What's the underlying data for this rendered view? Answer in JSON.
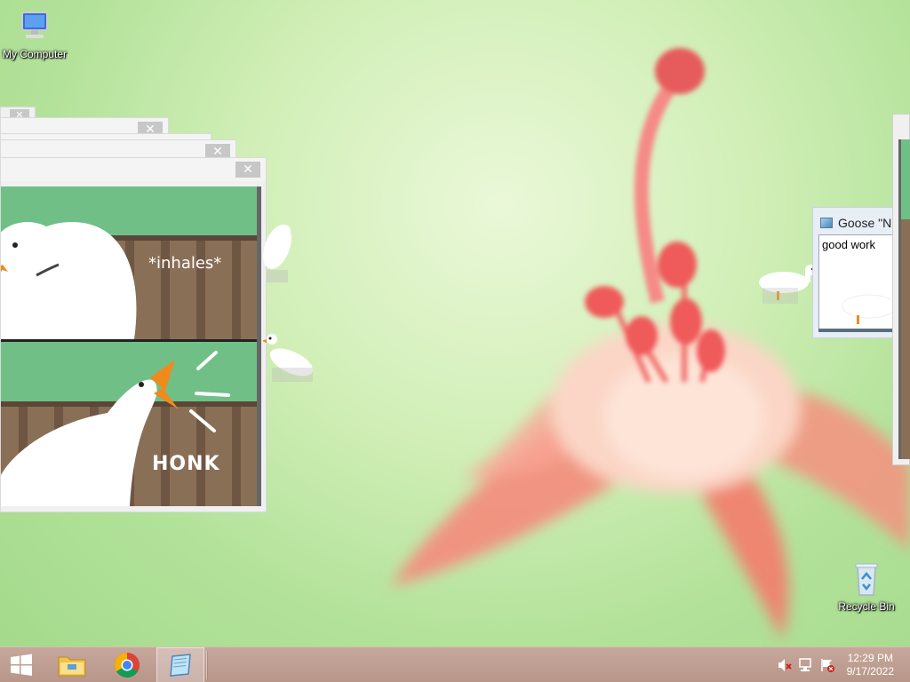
{
  "desktop": {
    "icons": [
      {
        "label": "My Computer",
        "icon": "computer-icon"
      },
      {
        "label": "Recycle Bin",
        "icon": "recycle-bin-icon"
      }
    ]
  },
  "meme_window": {
    "close_label": "✕",
    "top_text": "*inhales*",
    "bottom_text": "HONK"
  },
  "notepad": {
    "title": "Goose \"N",
    "content": "good work"
  },
  "taskbar": {
    "items": [
      "start-icon",
      "file-explorer-icon",
      "chrome-icon",
      "notepad-icon"
    ],
    "clock_time": "12:29 PM",
    "clock_date": "9/17/2022",
    "tray": [
      "volume-muted-icon",
      "network-icon",
      "action-center-flag-icon"
    ]
  },
  "colors": {
    "taskbar": "#b8968a",
    "meme_green": "#6fbf86",
    "fence": "#8a6f57",
    "goose_beak": "#f08a1c"
  }
}
